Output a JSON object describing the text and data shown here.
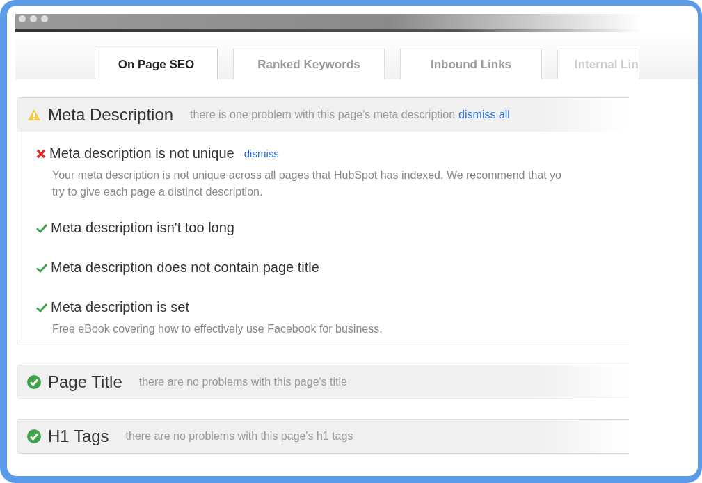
{
  "tabs": [
    {
      "label": "On Page SEO",
      "selected": true
    },
    {
      "label": "Ranked Keywords",
      "selected": false
    },
    {
      "label": "Inbound Links",
      "selected": false
    },
    {
      "label": "Internal Lin",
      "selected": false
    }
  ],
  "sections": [
    {
      "kind": "warning",
      "title": "Meta Description",
      "summary": "there is one problem with this page's meta description",
      "action": "dismiss all",
      "checks": [
        {
          "kind": "fail",
          "label": "Meta description is not unique",
          "action": "dismiss",
          "detail": "Your meta description is not unique across all pages that HubSpot has indexed. We recommend that yo\ntry to give each page a distinct description."
        },
        {
          "kind": "pass",
          "label": "Meta description isn't too long"
        },
        {
          "kind": "pass",
          "label": "Meta description does not contain page title"
        },
        {
          "kind": "pass",
          "label": "Meta description is set",
          "detail": "Free eBook covering how to effectively use Facebook for business."
        }
      ]
    },
    {
      "kind": "ok",
      "title": "Page Title",
      "summary": "there are no problems with this page's title"
    },
    {
      "kind": "ok",
      "title": "H1 Tags",
      "summary": "there are no problems with this page's h1 tags"
    }
  ]
}
